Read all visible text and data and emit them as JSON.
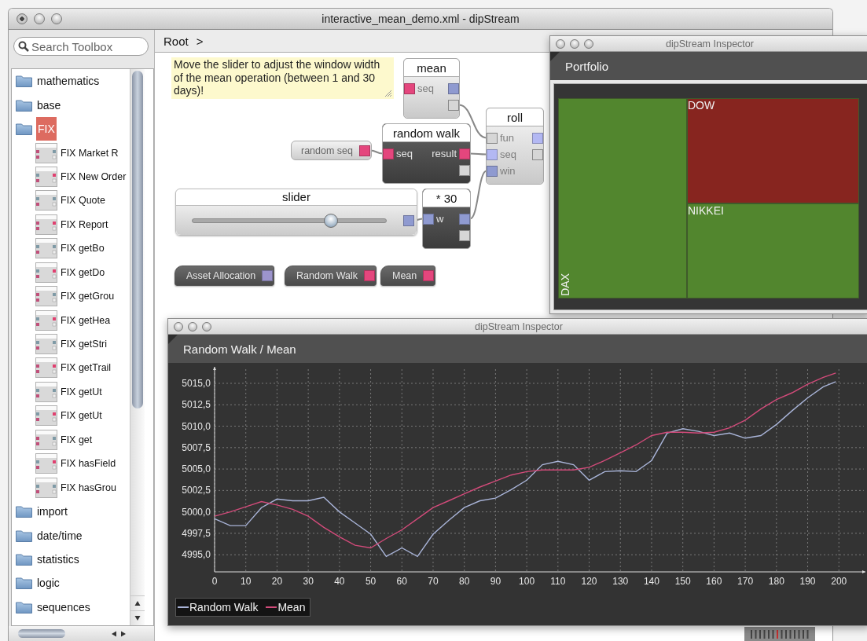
{
  "window": {
    "title": "interactive_mean_demo.xml - dipStream"
  },
  "toolbox": {
    "search": {
      "placeholder": "Search Toolbox"
    },
    "items": [
      {
        "label": "mathematics",
        "selected": false
      },
      {
        "label": "base",
        "selected": false
      },
      {
        "label": "FIX",
        "selected": true,
        "children": [
          {
            "label": "FIX Market R"
          },
          {
            "label": "FIX New Order"
          },
          {
            "label": "FIX Quote"
          },
          {
            "label": "FIX Report"
          },
          {
            "label": "FIX getBo"
          },
          {
            "label": "FIX getDo"
          },
          {
            "label": "FIX getGrou"
          },
          {
            "label": "FIX getHea"
          },
          {
            "label": "FIX getStri"
          },
          {
            "label": "FIX getTrail"
          },
          {
            "label": "FIX getUt"
          },
          {
            "label": "FIX getUt"
          },
          {
            "label": "FIX get"
          },
          {
            "label": "FIX hasField"
          },
          {
            "label": "FIX hasGrou"
          }
        ]
      },
      {
        "label": "import",
        "selected": false
      },
      {
        "label": "date/time",
        "selected": false
      },
      {
        "label": "statistics",
        "selected": false
      },
      {
        "label": "logic",
        "selected": false
      },
      {
        "label": "sequences",
        "selected": false
      }
    ]
  },
  "breadcrumb": {
    "path": "Root",
    "separator": ">"
  },
  "canvas": {
    "nodes": [
      {
        "kind": "note",
        "text": "Move the slider to adjust the window width of the mean operation (between 1 and 30 days)!"
      },
      {
        "kind": "block",
        "dark": false,
        "title": "mean",
        "rows": [
          {
            "in": {
              "kind": "typed",
              "color": "#e4467d"
            },
            "label": "seq",
            "out": {
              "kind": "typed",
              "color": "#8f9ad0"
            }
          },
          {
            "out": {
              "kind": "empty"
            }
          }
        ]
      },
      {
        "kind": "source",
        "label": "random seq",
        "port": {
          "kind": "typed",
          "color": "#e4467d"
        }
      },
      {
        "kind": "block",
        "dark": true,
        "title": "random walk",
        "rows": [
          {
            "in": {
              "kind": "typed",
              "color": "#e4467d"
            },
            "label": "seq",
            "label_out": "result",
            "out": {
              "kind": "typed",
              "color": "#e4467d"
            }
          },
          {
            "out": {
              "kind": "empty"
            }
          }
        ]
      },
      {
        "kind": "block",
        "dark": false,
        "title": "roll",
        "rows": [
          {
            "in": {
              "kind": "empty"
            },
            "label": "fun",
            "out": {
              "kind": "typed",
              "color": "#b3b8f3"
            }
          },
          {
            "in": {
              "kind": "typed",
              "color": "#b3b8f3"
            },
            "label": "seq",
            "out": {
              "kind": "empty"
            }
          },
          {
            "in": {
              "kind": "typed",
              "color": "#8f9ad0"
            },
            "label": "win"
          }
        ]
      },
      {
        "kind": "slider",
        "title": "slider",
        "level": 0.73,
        "port": {
          "kind": "typed",
          "color": "#8f9ad0"
        }
      },
      {
        "kind": "block",
        "dark": true,
        "title": "* 30",
        "rows": [
          {
            "in": {
              "kind": "typed",
              "color": "#8f9ad0"
            },
            "label": "w",
            "out": {
              "kind": "typed",
              "color": "#8f9ad0"
            }
          },
          {
            "out": {
              "kind": "empty"
            }
          }
        ]
      },
      {
        "kind": "output",
        "label": "Asset Allocation",
        "port": {
          "kind": "typed",
          "color": "#9c94cc"
        }
      },
      {
        "kind": "output",
        "label": "Random Walk",
        "port": {
          "kind": "typed",
          "color": "#e4467d"
        }
      },
      {
        "kind": "output",
        "label": "Mean",
        "port": {
          "kind": "typed",
          "color": "#e4467d"
        }
      }
    ]
  },
  "inspectors": [
    {
      "title": "dipStream Inspector",
      "heading": "Portfolio",
      "kind": "treemap",
      "cells": [
        {
          "label": "DAX",
          "color": "#52862e",
          "label_rotated": true
        },
        {
          "label": "DOW",
          "color": "#87251f",
          "label_rotated": false
        },
        {
          "label": "NIKKEI",
          "color": "#52862e",
          "label_rotated": false
        }
      ]
    },
    {
      "title": "dipStream Inspector",
      "heading": "Random Walk / Mean",
      "kind": "chart",
      "chart_data": {
        "type": "line",
        "grid": true,
        "x": [
          0,
          5,
          10,
          15,
          20,
          25,
          30,
          35,
          40,
          45,
          50,
          55,
          60,
          65,
          70,
          75,
          80,
          85,
          90,
          95,
          100,
          105,
          110,
          115,
          120,
          125,
          130,
          135,
          140,
          145,
          150,
          155,
          160,
          165,
          170,
          175,
          180,
          185,
          190,
          195,
          199
        ],
        "series": [
          {
            "name": "Random Walk",
            "color": "#a9b4d8",
            "values": [
              4999.2,
              4998.4,
              4998.4,
              5000.5,
              5001.5,
              5001.3,
              5001.3,
              5001.7,
              5000.0,
              4998.7,
              4997.4,
              4994.8,
              4995.8,
              4994.8,
              4997.4,
              4999.0,
              5000.5,
              5001.3,
              5001.6,
              5002.6,
              5003.7,
              5005.5,
              5005.9,
              5005.5,
              5003.7,
              5004.7,
              5004.8,
              5004.7,
              5006.0,
              5009.2,
              5009.7,
              5009.4,
              5008.9,
              5009.2,
              5008.6,
              5008.9,
              5010.2,
              5011.8,
              5013.3,
              5014.6,
              5015.2
            ]
          },
          {
            "name": "Mean",
            "color": "#d24b7a",
            "values": [
              4999.5,
              5000.0,
              5000.6,
              5001.2,
              5000.8,
              5000.3,
              4999.5,
              4998.2,
              4997.1,
              4996.1,
              4995.8,
              4996.9,
              4997.9,
              4999.2,
              5000.5,
              5001.3,
              5002.1,
              5002.9,
              5003.6,
              5004.3,
              5004.7,
              5004.9,
              5004.9,
              5004.9,
              5005.2,
              5006.0,
              5006.9,
              5007.8,
              5008.9,
              5009.3,
              5009.3,
              5009.2,
              5009.3,
              5009.8,
              5010.7,
              5012.0,
              5013.1,
              5013.9,
              5014.9,
              5015.7,
              5016.2
            ]
          }
        ],
        "xlim": [
          0,
          208
        ],
        "ylim": [
          4993,
          5016.65
        ],
        "xticks": [
          0,
          10,
          20,
          30,
          40,
          50,
          60,
          70,
          80,
          90,
          100,
          110,
          120,
          130,
          140,
          150,
          160,
          170,
          180,
          190,
          200
        ],
        "yticks": [
          {
            "value": 4995,
            "label": "4995,0"
          },
          {
            "value": 4997.5,
            "label": "4997,5"
          },
          {
            "value": 5000,
            "label": "5000,0"
          },
          {
            "value": 5002.5,
            "label": "5002,5"
          },
          {
            "value": 5005,
            "label": "5005,0"
          },
          {
            "value": 5007.5,
            "label": "5007,5"
          },
          {
            "value": 5010,
            "label": "5010,0"
          },
          {
            "value": 5012.5,
            "label": "5012,5"
          },
          {
            "value": 5015,
            "label": "5015,0"
          }
        ]
      }
    }
  ]
}
